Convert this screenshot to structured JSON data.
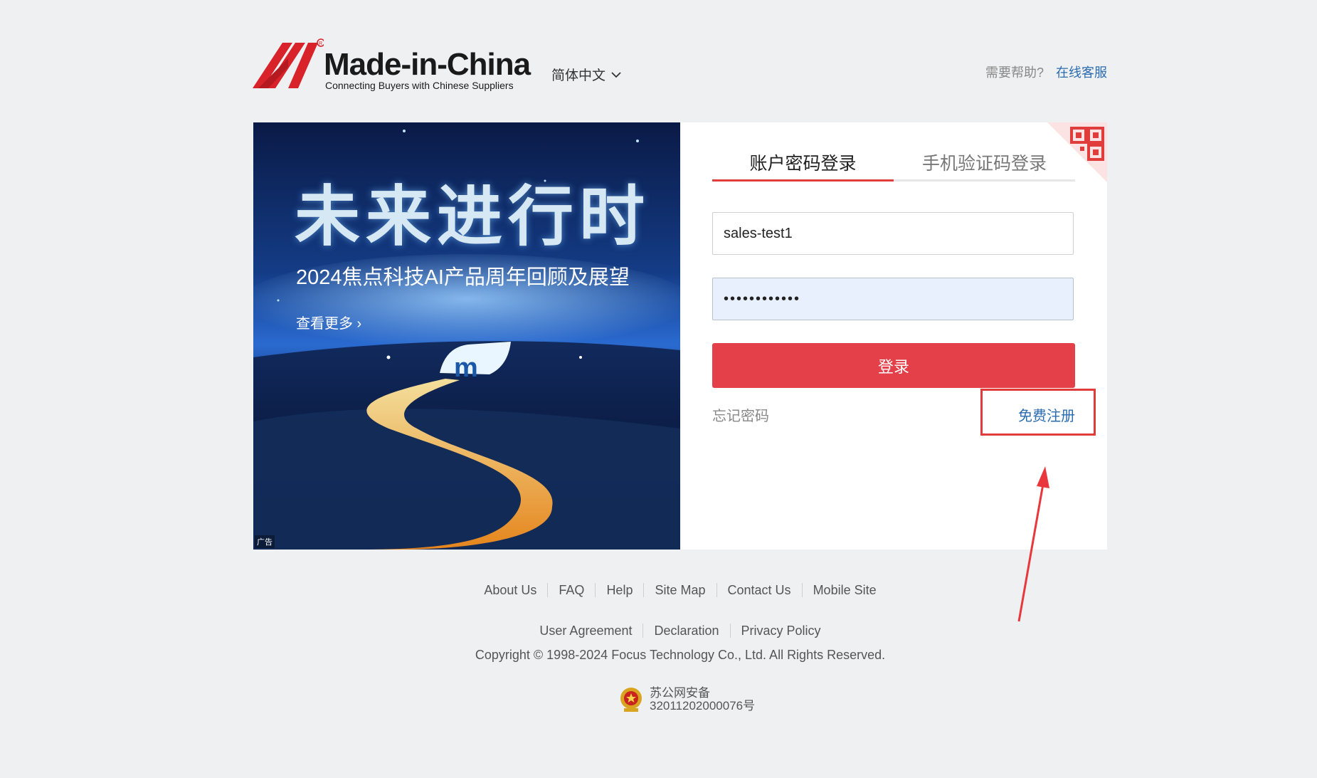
{
  "header": {
    "logo_word": "Made-in-China",
    "logo_tagline": "Connecting Buyers with Chinese Suppliers",
    "language": "简体中文",
    "help_question": "需要帮助?",
    "help_link": "在线客服"
  },
  "banner": {
    "headline": "未来进行时",
    "subtitle": "2024焦点科技AI产品周年回顾及展望",
    "more": "查看更多 ›",
    "ad_tag": "广告"
  },
  "login": {
    "tabs": [
      {
        "label": "账户密码登录",
        "active": true
      },
      {
        "label": "手机验证码登录",
        "active": false
      }
    ],
    "username_value": "sales-test1",
    "password_value": "••••••••••••",
    "submit_label": "登录",
    "forgot_label": "忘记密码",
    "register_label": "免费注册"
  },
  "footer": {
    "links_row1": [
      "About Us",
      "FAQ",
      "Help",
      "Site Map",
      "Contact Us",
      "Mobile Site"
    ],
    "links_row2": [
      "User Agreement",
      "Declaration",
      "Privacy Policy"
    ],
    "copyright": "Copyright © 1998-2024 Focus Technology Co., Ltd. All Rights Reserved.",
    "police_line1": "苏公网安备",
    "police_line2": "32011202000076号"
  },
  "colors": {
    "brand_red": "#e4404a",
    "link_blue": "#2b6cb0",
    "page_bg": "#eff0f2"
  }
}
